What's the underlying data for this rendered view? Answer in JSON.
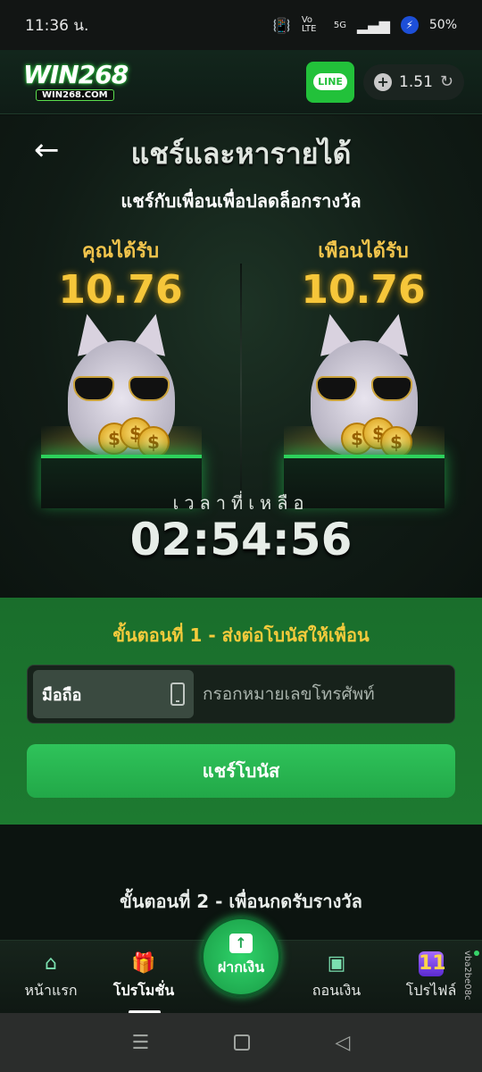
{
  "status_bar": {
    "time": "11:36 น.",
    "network": "Vo LTE",
    "signal": "5G",
    "battery": "50%"
  },
  "header": {
    "logo_main": "WIN268",
    "logo_sub": "WIN268.COM",
    "line_label": "LINE",
    "balance": "1.51"
  },
  "hero": {
    "title": "แชร์และหารายได้",
    "subtitle": "แชร์กับเพื่อนเพื่อปลดล็อกรางวัล",
    "you_get_label": "คุณได้รับ",
    "you_get_value": "10.76",
    "friend_gets_label": "เพือนได้รับ",
    "friend_gets_value": "10.76",
    "time_left_label": "เวลาที่เหลือ",
    "countdown": "02:54:56"
  },
  "step1": {
    "title": "ขั้นตอนที่ 1 - ส่งต่อโบนัสให้เพื่อน",
    "prefix_label": "มือถือ",
    "phone_placeholder": "กรอกหมายเลขโทรศัพท์",
    "share_button": "แชร์โบนัส"
  },
  "step2": {
    "title": "ขั้นตอนที่ 2 - เพื่อนกดรับรางวัล"
  },
  "bottom_nav": {
    "home": "หน้าแรก",
    "promotions": "โปรโมชั่น",
    "deposit": "ฝากเงิน",
    "withdraw": "ถอนเงิน",
    "profile": "โปรไฟล์",
    "profile_badge": "11"
  },
  "side_tag": "vba2be08c",
  "colors": {
    "accent_green": "#22a848",
    "gold": "#f6c63a",
    "step_title": "#f5cb3c"
  }
}
